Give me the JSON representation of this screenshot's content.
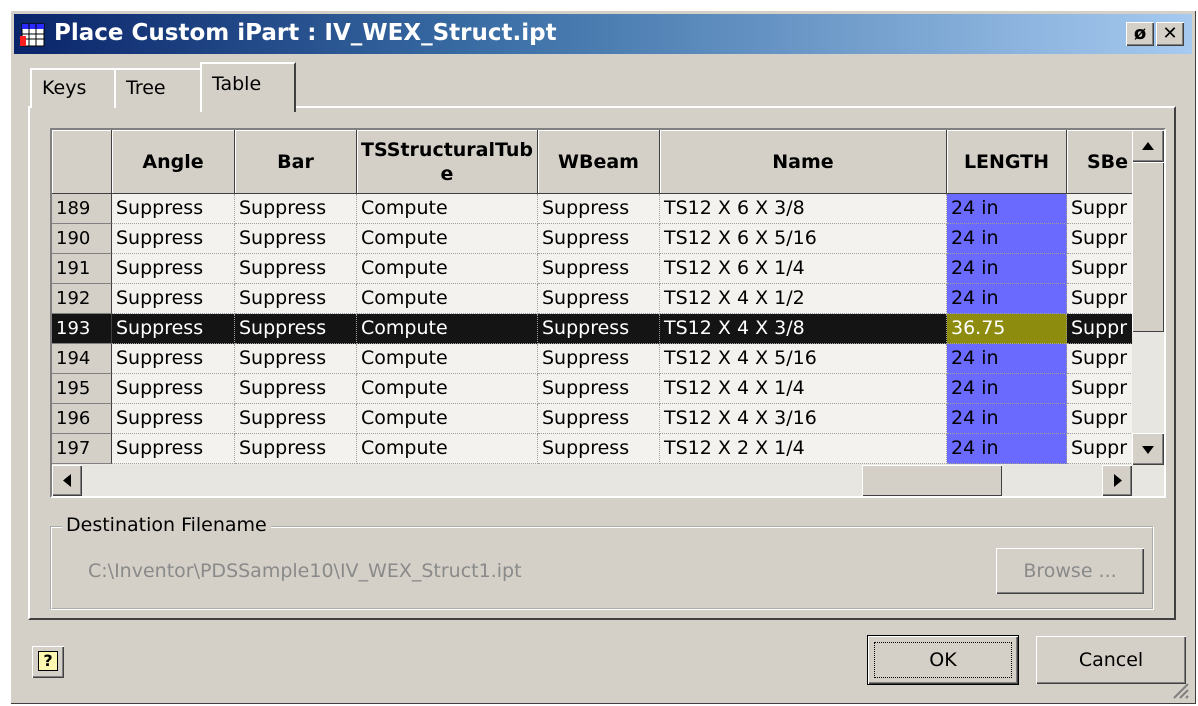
{
  "window": {
    "title": "Place Custom iPart : IV_WEX_Struct.ipt",
    "pin_label": "ø",
    "close_label": "✕"
  },
  "tabs": [
    {
      "label": "Keys",
      "active": false
    },
    {
      "label": "Tree",
      "active": false
    },
    {
      "label": "Table",
      "active": true
    }
  ],
  "table": {
    "columns": [
      "Angle",
      "Bar",
      "TSStructuralTube",
      "WBeam",
      "Name",
      "LENGTH",
      "SBe"
    ],
    "rows": [
      {
        "num": "189",
        "cells": [
          "Suppress",
          "Suppress",
          "Compute",
          "Suppress",
          "TS12 X 6 X 3/8",
          "24 in",
          "Suppr"
        ]
      },
      {
        "num": "190",
        "cells": [
          "Suppress",
          "Suppress",
          "Compute",
          "Suppress",
          "TS12 X 6 X 5/16",
          "24 in",
          "Suppr"
        ]
      },
      {
        "num": "191",
        "cells": [
          "Suppress",
          "Suppress",
          "Compute",
          "Suppress",
          "TS12 X 6 X 1/4",
          "24 in",
          "Suppr"
        ]
      },
      {
        "num": "192",
        "cells": [
          "Suppress",
          "Suppress",
          "Compute",
          "Suppress",
          "TS12 X 4 X 1/2",
          "24 in",
          "Suppr"
        ]
      },
      {
        "num": "193",
        "cells": [
          "Suppress",
          "Suppress",
          "Compute",
          "Suppress",
          "TS12 X 4 X 3/8",
          "36.75",
          "Suppr"
        ],
        "selected": true
      },
      {
        "num": "194",
        "cells": [
          "Suppress",
          "Suppress",
          "Compute",
          "Suppress",
          "TS12 X 4 X 5/16",
          "24 in",
          "Suppr"
        ]
      },
      {
        "num": "195",
        "cells": [
          "Suppress",
          "Suppress",
          "Compute",
          "Suppress",
          "TS12 X 4 X 1/4",
          "24 in",
          "Suppr"
        ]
      },
      {
        "num": "196",
        "cells": [
          "Suppress",
          "Suppress",
          "Compute",
          "Suppress",
          "TS12 X 4 X 3/16",
          "24 in",
          "Suppr"
        ]
      },
      {
        "num": "197",
        "cells": [
          "Suppress",
          "Suppress",
          "Compute",
          "Suppress",
          "TS12 X 2 X 1/4",
          "24 in",
          "Suppr"
        ]
      }
    ]
  },
  "destination": {
    "legend": "Destination Filename",
    "path": "C:\\Inventor\\PDSSample10\\IV_WEX_Struct1.ipt",
    "browse_label": "Browse ..."
  },
  "buttons": {
    "help_label": "?",
    "ok_label": "OK",
    "cancel_label": "Cancel"
  },
  "colors": {
    "length_column": "#6a6aff",
    "selected_row": "#141414",
    "selected_length": "#8e8c0e",
    "title_gradient_start": "#0a246a"
  }
}
